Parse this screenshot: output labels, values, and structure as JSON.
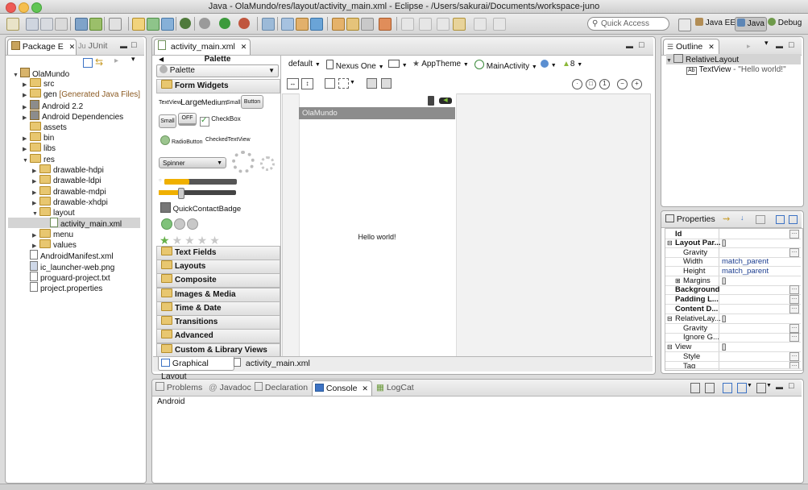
{
  "window": {
    "title": "Java - OlaMundo/res/layout/activity_main.xml - Eclipse - /Users/sakurai/Documents/workspace-juno"
  },
  "toolbar": {
    "quick_access_placeholder": "Quick Access"
  },
  "perspectives": [
    {
      "label": "Java EE"
    },
    {
      "label": "Java"
    },
    {
      "label": "Debug"
    }
  ],
  "package_explorer": {
    "tabs": [
      {
        "label": "Package E"
      },
      {
        "label": "JUnit"
      }
    ],
    "tree": [
      {
        "label": "OlaMundo",
        "depth": 0
      },
      {
        "label": "src",
        "depth": 1
      },
      {
        "label": "gen",
        "suffix": "[Generated Java Files]",
        "depth": 1
      },
      {
        "label": "Android 2.2",
        "depth": 1
      },
      {
        "label": "Android Dependencies",
        "depth": 1
      },
      {
        "label": "assets",
        "depth": 1
      },
      {
        "label": "bin",
        "depth": 1
      },
      {
        "label": "libs",
        "depth": 1
      },
      {
        "label": "res",
        "depth": 1
      },
      {
        "label": "drawable-hdpi",
        "depth": 2
      },
      {
        "label": "drawable-ldpi",
        "depth": 2
      },
      {
        "label": "drawable-mdpi",
        "depth": 2
      },
      {
        "label": "drawable-xhdpi",
        "depth": 2
      },
      {
        "label": "layout",
        "depth": 2
      },
      {
        "label": "activity_main.xml",
        "depth": 3
      },
      {
        "label": "menu",
        "depth": 2
      },
      {
        "label": "values",
        "depth": 2
      },
      {
        "label": "AndroidManifest.xml",
        "depth": 1
      },
      {
        "label": "ic_launcher-web.png",
        "depth": 1
      },
      {
        "label": "proguard-project.txt",
        "depth": 1
      },
      {
        "label": "project.properties",
        "depth": 1
      }
    ]
  },
  "editor": {
    "tab_label": "activity_main.xml",
    "palette": {
      "title": "Palette",
      "dropdown": "Palette",
      "sections": [
        "Form Widgets",
        "Text Fields",
        "Layouts",
        "Composite",
        "Images & Media",
        "Time & Date",
        "Transitions",
        "Advanced",
        "Custom & Library Views"
      ],
      "widgets": {
        "textview": "TextView",
        "large": "Large",
        "medium": "Medium",
        "small": "Small",
        "button": "Button",
        "small_btn": "Small",
        "off": "OFF",
        "checkbox": "CheckBox",
        "radiobutton": "RadioButton",
        "checkedtextview": "CheckedTextView",
        "spinner": "Spinner",
        "quickcontactbadge": "QuickContactBadge"
      }
    },
    "config_bar": {
      "config": "default",
      "device": "Nexus One",
      "theme": "AppTheme",
      "activity": "MainActivity",
      "api": "8"
    },
    "canvas": {
      "app_title": "OlaMundo",
      "content_text": "Hello world!"
    },
    "bottom_tabs": [
      {
        "label": "Graphical Layout"
      },
      {
        "label": "activity_main.xml"
      }
    ]
  },
  "outline": {
    "title": "Outline",
    "items": [
      {
        "label": "RelativeLayout"
      },
      {
        "label": "TextView",
        "suffix": " - \"Hello world!\""
      }
    ]
  },
  "properties": {
    "title": "Properties",
    "rows": [
      {
        "key": "Id",
        "value": "",
        "bold": true
      },
      {
        "key": "Layout Par...",
        "value": "[]",
        "bold": true
      },
      {
        "key": "Gravity",
        "value": ""
      },
      {
        "key": "Width",
        "value": "match_parent"
      },
      {
        "key": "Height",
        "value": "match_parent"
      },
      {
        "key": "Margins",
        "value": "[]"
      },
      {
        "key": "Background",
        "value": "",
        "bold": true
      },
      {
        "key": "Padding L...",
        "value": "",
        "bold": true
      },
      {
        "key": "Content D...",
        "value": "",
        "bold": true
      },
      {
        "key": "RelativeLay...",
        "value": "[]"
      },
      {
        "key": "Gravity",
        "value": ""
      },
      {
        "key": "Ignore G...",
        "value": ""
      },
      {
        "key": "View",
        "value": "[]"
      },
      {
        "key": "Style",
        "value": ""
      },
      {
        "key": "Tag",
        "value": ""
      }
    ]
  },
  "console": {
    "tabs": [
      {
        "label": "Problems"
      },
      {
        "label": "Javadoc"
      },
      {
        "label": "Declaration"
      },
      {
        "label": "Console"
      },
      {
        "label": "LogCat"
      }
    ],
    "content": "Android"
  },
  "colors": {
    "accent": "#3875d7",
    "canvas_title_bar": "#8c8c8c",
    "selection": "#d4d4d4"
  }
}
